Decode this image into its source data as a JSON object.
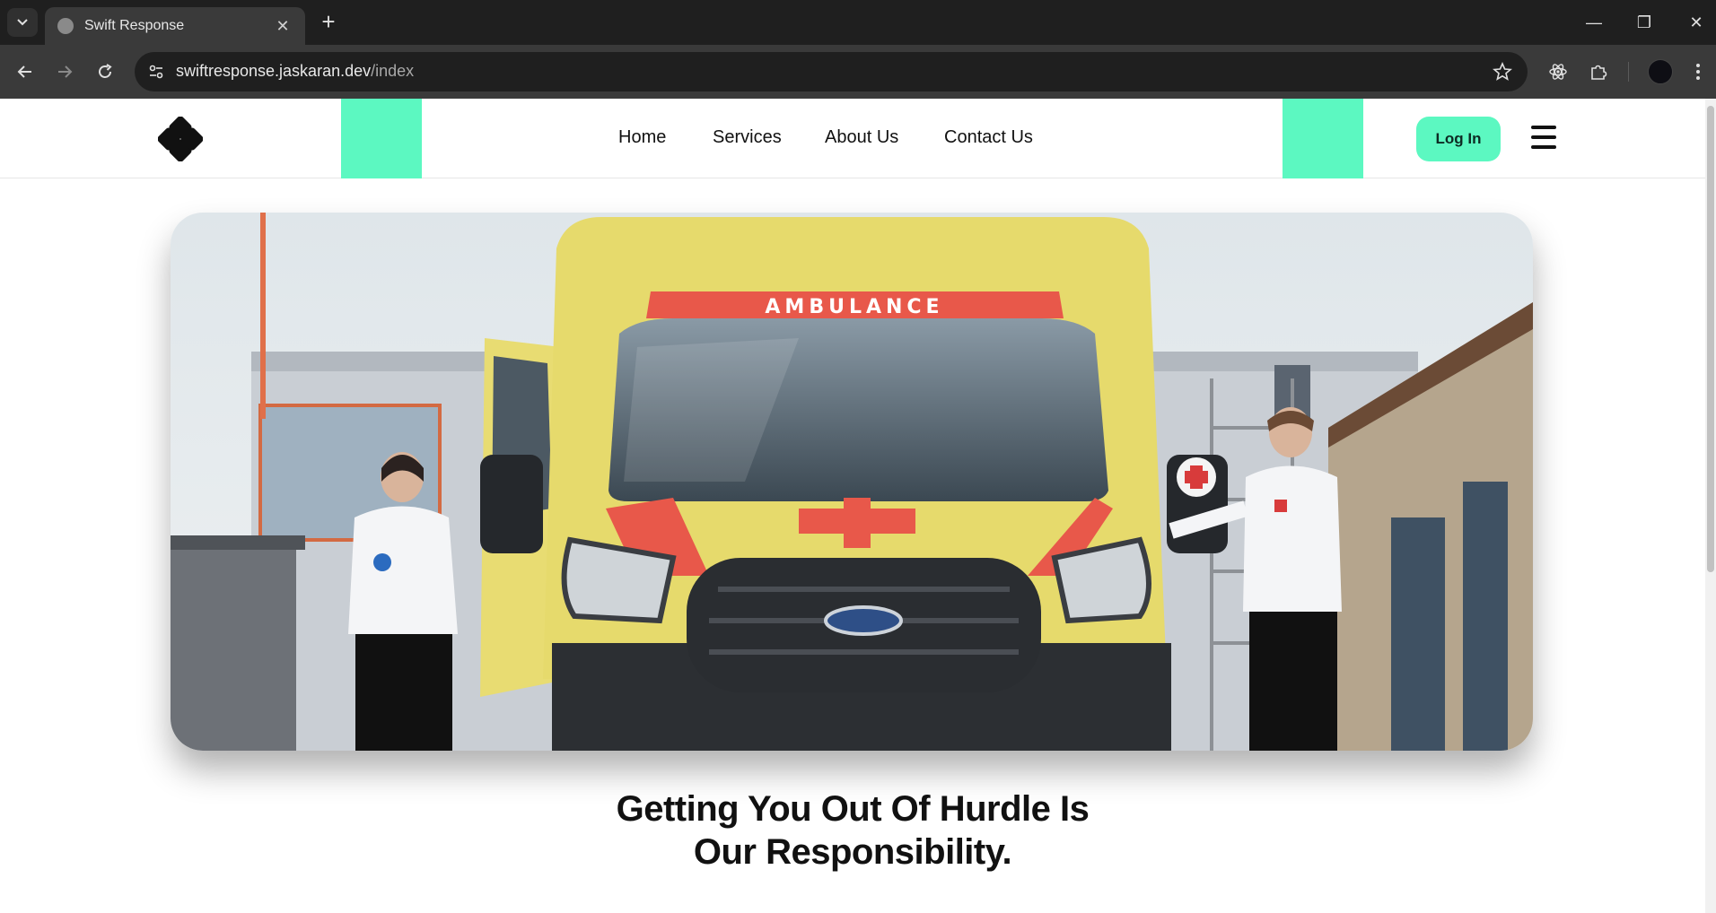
{
  "browser": {
    "tab_title": "Swift Response",
    "url_host": "swiftresponse.jaskaran.dev",
    "url_path": "/index"
  },
  "header": {
    "nav": [
      "Home",
      "Services",
      "About Us",
      "Contact Us"
    ],
    "login_label": "Log In"
  },
  "hero": {
    "vehicle_label": "AMBULANCE",
    "headline_line1": "Getting You Out Of Hurdle Is",
    "headline_line2": "Our Responsibility."
  },
  "colors": {
    "accent": "#5cf8c1",
    "chrome_dark": "#1f1f1f",
    "chrome_toolbar": "#3a3a3a",
    "ambulance_yellow": "#e6da6c",
    "ambulance_red": "#e8584a"
  }
}
